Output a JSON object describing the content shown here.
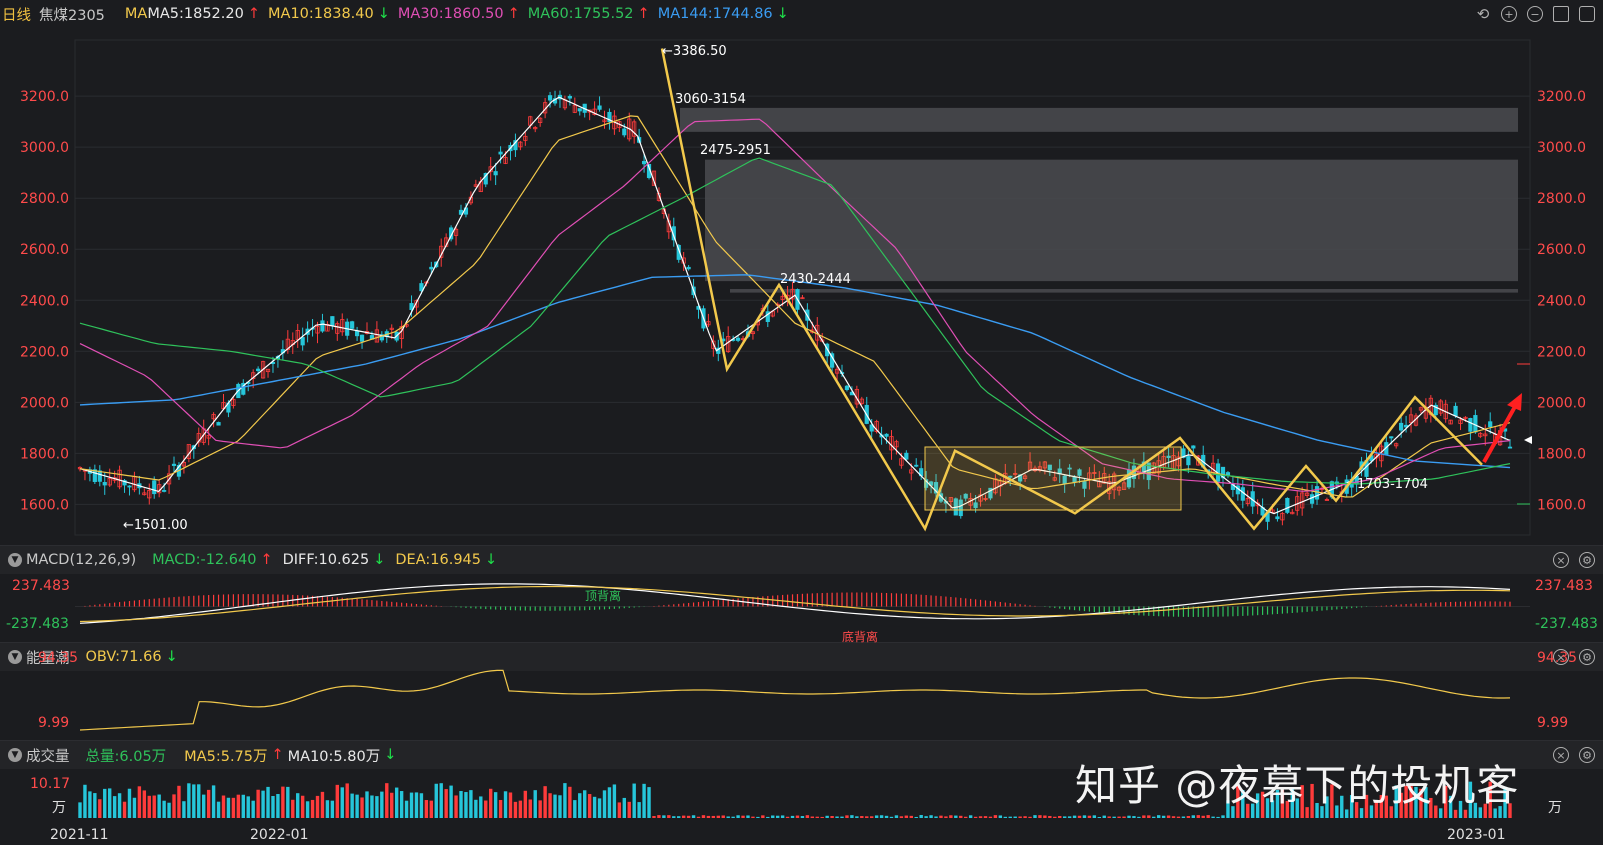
{
  "header": {
    "period": "日线",
    "symbol": "焦煤2305",
    "ma_label": "MA",
    "ma": [
      {
        "label": "MA5:1852.20",
        "dir": "↑",
        "color": "#f2c94c"
      },
      {
        "label": "MA10:1838.40",
        "dir": "↓",
        "color": "#f2c94c"
      },
      {
        "label": "MA30:1860.50",
        "dir": "↑",
        "color": "#e04fb5"
      },
      {
        "label": "MA60:1755.52",
        "dir": "↑",
        "color": "#2fc25b"
      },
      {
        "label": "MA144:1744.86",
        "dir": "↓",
        "color": "#3a9cf2"
      }
    ]
  },
  "main_axis": {
    "ticks": [
      "3200.0",
      "3000.0",
      "2800.0",
      "2600.0",
      "2400.0",
      "2200.0",
      "2000.0",
      "1800.0",
      "1600.0"
    ]
  },
  "annotations": {
    "high": "←3386.50",
    "low": "←1501.00",
    "zone1": "3060-3154",
    "zone2": "2475-2951",
    "zone3": "2430-2444",
    "zone4": "1703-1704"
  },
  "macd": {
    "title": "MACD(12,26,9)",
    "macd": "MACD:-12.640",
    "diff": "DIFF:10.625",
    "dea": "DEA:16.945",
    "top": "237.483",
    "bottom": "-237.483",
    "label_top_div": "顶背离",
    "label_bot_div": "底背离"
  },
  "obv": {
    "title": "能量潮",
    "value": "OBV:71.66",
    "top": "94.35",
    "bottom": "9.99"
  },
  "volume": {
    "title": "成交量",
    "total": "总量:6.05万",
    "ma5": "MA5:5.75万",
    "ma10": "MA10:5.80万",
    "top": "10.17",
    "unit": "万"
  },
  "xaxis": {
    "labels": [
      "2021-11",
      "2022-01",
      "2023-01"
    ]
  },
  "watermark": "知乎 @夜幕下的投机客",
  "chart_data": {
    "type": "line",
    "title": "",
    "ylim": [
      1480,
      3420
    ],
    "x": [
      "2021-11",
      "2022-01",
      "2023-01"
    ],
    "series": [
      {
        "name": "MA5",
        "values": [
          1740,
          1650,
          2050,
          2310,
          2250,
          2850,
          3200,
          3060,
          2200,
          2420,
          1900,
          1580,
          1740,
          1680,
          1800,
          1560,
          1690,
          1990,
          1850
        ]
      },
      {
        "name": "MA144",
        "values": [
          1990,
          2010,
          2080,
          2150,
          2250,
          2390,
          2490,
          2500,
          2450,
          2380,
          2270,
          2100,
          1960,
          1850,
          1770,
          1744
        ]
      }
    ],
    "zones": [
      "3060-3154",
      "2475-2951",
      "2430-2444"
    ],
    "extremes": {
      "high": 3386.5,
      "low": 1501.0
    }
  }
}
